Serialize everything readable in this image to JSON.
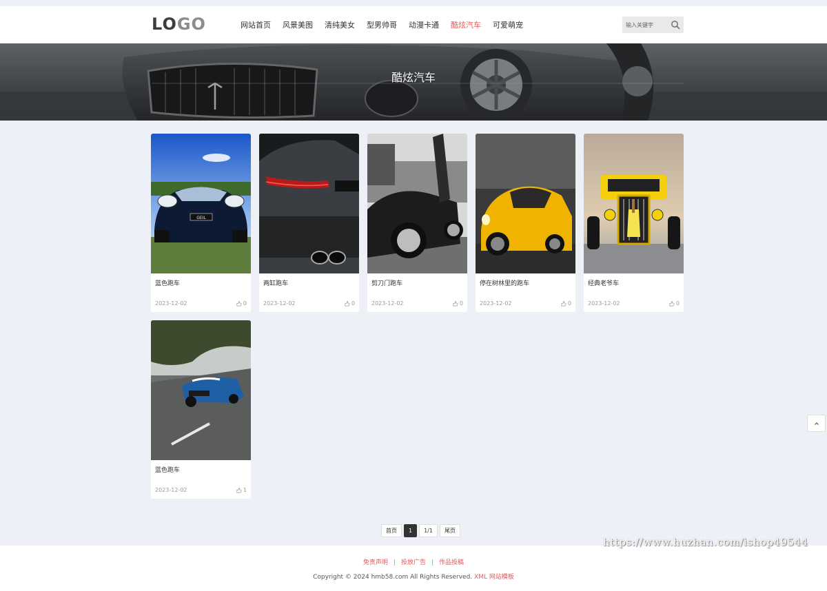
{
  "header": {
    "logo": {
      "main": "LO",
      "accent": "GO"
    },
    "nav": [
      {
        "label": "网站首页",
        "active": false
      },
      {
        "label": "风景美图",
        "active": false
      },
      {
        "label": "清纯美女",
        "active": false
      },
      {
        "label": "型男帅哥",
        "active": false
      },
      {
        "label": "动漫卡通",
        "active": false
      },
      {
        "label": "酷炫汽车",
        "active": true
      },
      {
        "label": "可爱萌宠",
        "active": false
      }
    ],
    "search": {
      "placeholder": "输入关键字"
    }
  },
  "banner": {
    "title": "酷炫汽车"
  },
  "cards": [
    {
      "title": "蓝色跑车",
      "date": "2023-12-02",
      "likes": "0"
    },
    {
      "title": "两缸跑车",
      "date": "2023-12-02",
      "likes": "0"
    },
    {
      "title": "剪刀门跑车",
      "date": "2023-12-02",
      "likes": "0"
    },
    {
      "title": "停在树林里的跑车",
      "date": "2023-12-02",
      "likes": "0"
    },
    {
      "title": "经典老爷车",
      "date": "2023-12-02",
      "likes": "0"
    },
    {
      "title": "蓝色跑车",
      "date": "2023-12-02",
      "likes": "1"
    }
  ],
  "pagination": {
    "first": "首页",
    "current": "1",
    "info": "1/1",
    "last": "尾页"
  },
  "footer": {
    "links": [
      "免责声明",
      "投放广告",
      "作品投稿"
    ],
    "copyright": "Copyright © 2024 hmb58.com All Rights Reserved.",
    "xml_link": "XML",
    "template_link": "网站模板"
  },
  "watermark": "https://www.huzhan.com/ishop49544",
  "colors": {
    "accent": "#e05a5a",
    "background": "#eef0f7"
  }
}
